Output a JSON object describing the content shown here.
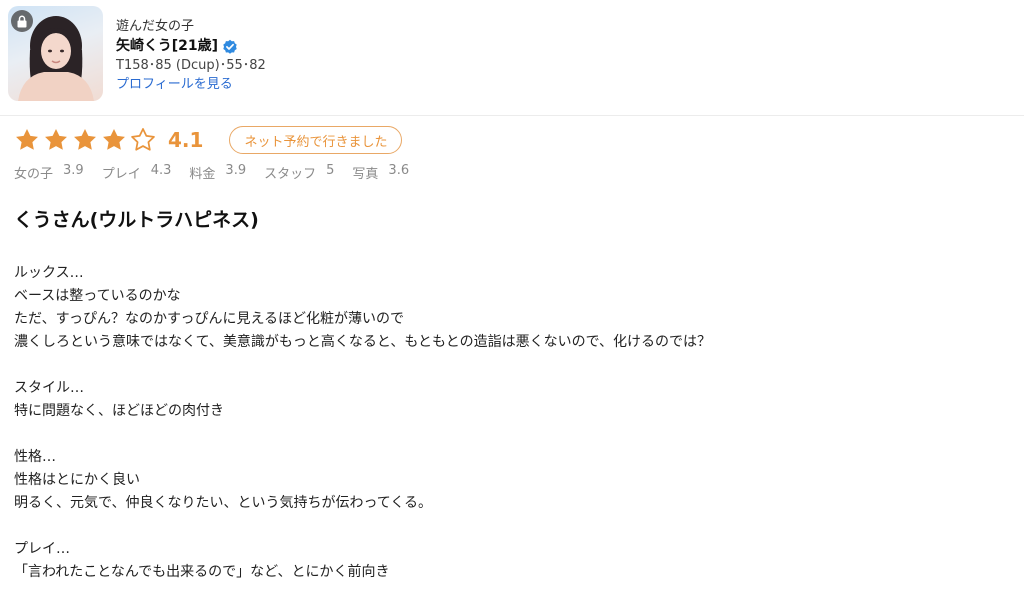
{
  "header": {
    "label": "遊んだ女の子",
    "name": "矢崎くう[21歳]",
    "stats": "T158･85 (Dcup)･55･82",
    "profile_link": "プロフィールを見る"
  },
  "rating": {
    "stars": 4,
    "max_stars": 5,
    "score": "4.1",
    "badge": "ネット予約で行きました",
    "accent_color": "#e9943b"
  },
  "sub_ratings": [
    {
      "label": "女の子",
      "value": "3.9"
    },
    {
      "label": "プレイ",
      "value": "4.3"
    },
    {
      "label": "料金",
      "value": "3.9"
    },
    {
      "label": "スタッフ",
      "value": "5"
    },
    {
      "label": "写真",
      "value": "3.6"
    }
  ],
  "review": {
    "title": "くうさん(ウルトラハピネス)",
    "lines": [
      "ルックス…",
      "ベースは整っているのかな",
      "ただ、すっぴん？なのかすっぴんに見えるほど化粧が薄いので",
      "濃くしろという意味ではなくて、美意識がもっと高くなると、もともとの造詣は悪くないので、化けるのでは？",
      "",
      "スタイル…",
      "特に問題なく、ほどほどの肉付き",
      "",
      "性格…",
      "性格はとにかく良い",
      "明るく、元気で、仲良くなりたい、という気持ちが伝わってくる。",
      "",
      "プレイ…",
      "「言われたことなんでも出来るので」など、とにかく前向き"
    ]
  },
  "icons": {
    "lock": "lock-icon",
    "verified": "verified-check-icon",
    "star": "star-icon"
  }
}
